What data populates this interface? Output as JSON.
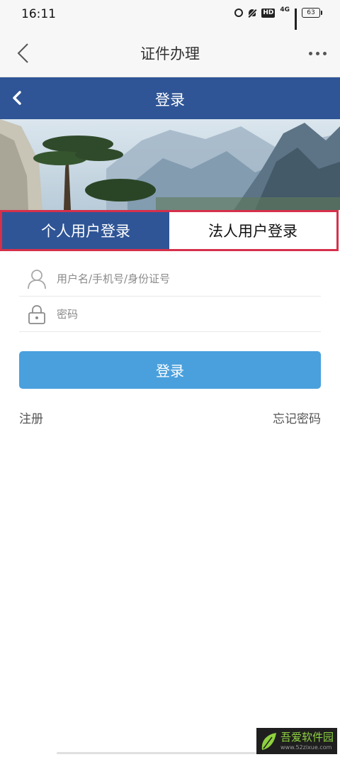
{
  "status_bar": {
    "time": "16:11",
    "network": "4G",
    "hd_badge": "HD",
    "battery": "63"
  },
  "app_header": {
    "title": "证件办理"
  },
  "login_header": {
    "title": "登录"
  },
  "tabs": [
    {
      "label": "个人用户登录",
      "active": true
    },
    {
      "label": "法人用户登录",
      "active": false
    }
  ],
  "form": {
    "username_placeholder": "用户名/手机号/身份证号",
    "username_value": "",
    "password_placeholder": "密码",
    "password_value": "",
    "login_button": "登录",
    "register_link": "注册",
    "forgot_link": "忘记密码"
  },
  "watermark": {
    "name": "吾爱软件园",
    "url": "www.52zixue.com"
  },
  "colors": {
    "header_blue": "#2f5596",
    "button_blue": "#4aa0dd",
    "highlight_red": "#d6304b"
  }
}
